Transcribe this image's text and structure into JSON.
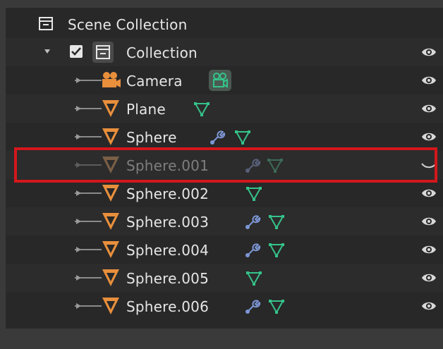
{
  "outliner": {
    "scene_collection": "Scene Collection",
    "collection": "Collection",
    "items": [
      {
        "label": "Camera",
        "type": "camera"
      },
      {
        "label": "Plane",
        "type": "mesh"
      },
      {
        "label": "Sphere",
        "type": "mesh"
      },
      {
        "label": "Sphere.001",
        "type": "mesh",
        "hidden": true
      },
      {
        "label": "Sphere.002",
        "type": "mesh"
      },
      {
        "label": "Sphere.003",
        "type": "mesh"
      },
      {
        "label": "Sphere.004",
        "type": "mesh"
      },
      {
        "label": "Sphere.005",
        "type": "mesh"
      },
      {
        "label": "Sphere.006",
        "type": "mesh"
      }
    ],
    "colors": {
      "mesh_orange": "#e88f3c",
      "data_green": "#35c38a",
      "modifier_blue": "#7d97d6",
      "highlight_red": "#d3181c"
    }
  }
}
